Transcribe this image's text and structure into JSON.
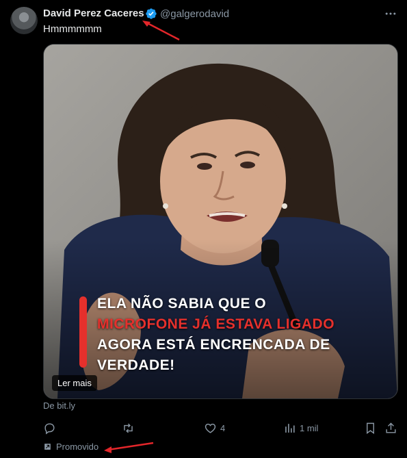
{
  "author": {
    "name": "David Perez Caceres",
    "handle": "@galgerodavid"
  },
  "tweet": {
    "text": "Hmmmmmm"
  },
  "card": {
    "headline_line1": "ELA NÃO SABIA QUE O",
    "headline_line2": "MICROFONE JÁ ESTAVA LIGADO",
    "headline_line3": "AGORA ESTÁ ENCRENCADA DE",
    "headline_line4": "VERDADE!",
    "read_more": "Ler mais",
    "source": "De bit.ly"
  },
  "actions": {
    "likes": "4",
    "views": "1 mil"
  },
  "promo": {
    "label": "Promovido"
  },
  "colors": {
    "background": "#000000",
    "text": "#e7e9ea",
    "muted": "#8b98a5",
    "verified": "#1d9bf0",
    "headline_red": "#e5302c",
    "annotation_arrow": "#e3262a"
  },
  "icons": [
    "verified-badge-icon",
    "more-options-icon",
    "reply-icon",
    "retweet-icon",
    "like-icon",
    "views-icon",
    "bookmark-icon",
    "share-icon",
    "promoted-icon"
  ]
}
